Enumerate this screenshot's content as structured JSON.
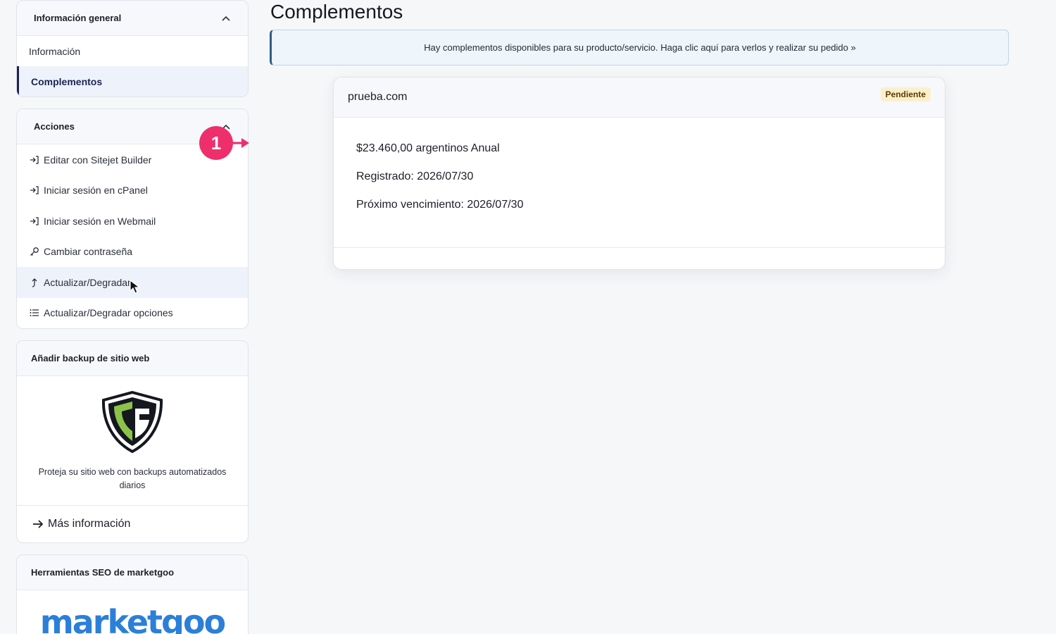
{
  "page": {
    "title": "Complementos"
  },
  "sidebar": {
    "overview": {
      "heading": "Información general",
      "items": [
        {
          "label": "Información",
          "active": false
        },
        {
          "label": "Complementos",
          "active": true
        }
      ]
    },
    "actions": {
      "heading": "Acciones",
      "items": [
        {
          "label": "Editar con Sitejet Builder",
          "icon": "login-arrow-icon"
        },
        {
          "label": "Iniciar sesión en cPanel",
          "icon": "login-arrow-icon"
        },
        {
          "label": "Iniciar sesión en Webmail",
          "icon": "login-arrow-icon"
        },
        {
          "label": "Cambiar contraseña",
          "icon": "key-icon"
        },
        {
          "label": "Actualizar/Degradar",
          "icon": "upgrade-arrow-icon"
        },
        {
          "label": "Actualizar/Degradar opciones",
          "icon": "list-icon"
        }
      ]
    },
    "backup": {
      "heading": "Añadir backup de sitio web",
      "description": "Proteja su sitio web con backups automatizados diarios",
      "link": "Más información"
    },
    "seo": {
      "heading": "Herramientas SEO de marketgoo",
      "logo_text": "marketgoo"
    }
  },
  "alert": {
    "text": "Hay complementos disponibles para su producto/servicio. Haga clic aquí para verlos y realizar su pedido »"
  },
  "addon_card": {
    "domain": "prueba.com",
    "status": "Pendiente",
    "price": "$23.460,00 argentinos Anual",
    "registered": "Registrado: 2026/07/30",
    "next_due": "Próximo vencimiento: 2026/07/30"
  },
  "step_marker": {
    "number": "1"
  },
  "colors": {
    "accent_navy": "#1d2452",
    "marker_pink": "#ee2f6c",
    "badge_bg": "#fbefcc",
    "alert_bg": "#eef5fb",
    "marketgoo_blue": "#2b7fd8",
    "shield_green": "#8bc34a"
  }
}
